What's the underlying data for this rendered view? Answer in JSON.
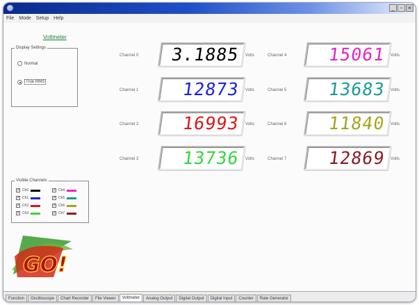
{
  "window": {
    "controls": {
      "minimize": "_",
      "restore": "▫",
      "close": "×"
    }
  },
  "menu": [
    "File",
    "Mode",
    "Setup",
    "Help"
  ],
  "panel": {
    "title": "Voltmeter"
  },
  "display_settings": {
    "legend": "Display Settings",
    "options": [
      {
        "label": "Normal",
        "selected": false
      },
      {
        "label": "True RMS",
        "selected": true
      }
    ]
  },
  "channels": [
    {
      "label": "Channel 0",
      "value": "3.1885",
      "unit": "Volts",
      "color": "#000000"
    },
    {
      "label": "Channel 1",
      "value": "12873",
      "unit": "Volts",
      "color": "#1a22d6"
    },
    {
      "label": "Channel 2",
      "value": "16993",
      "unit": "Volts",
      "color": "#e01414"
    },
    {
      "label": "Channel 3",
      "value": "13736",
      "unit": "Volts",
      "color": "#34d63a"
    },
    {
      "label": "Channel 4",
      "value": "15061",
      "unit": "Volts",
      "color": "#e623c9"
    },
    {
      "label": "Channel 5",
      "value": "13683",
      "unit": "Volts",
      "color": "#1a9b91"
    },
    {
      "label": "Channel 6",
      "value": "11840",
      "unit": "Volts",
      "color": "#a7a31c"
    },
    {
      "label": "Channel 7",
      "value": "12869",
      "unit": "Volts",
      "color": "#8a1a24"
    }
  ],
  "visible_channels": {
    "legend": "Visible Channels",
    "items": [
      {
        "label": "Ch0",
        "checked": true,
        "color": "#000000"
      },
      {
        "label": "Ch1",
        "checked": true,
        "color": "#1a22d6"
      },
      {
        "label": "Ch2",
        "checked": true,
        "color": "#e01414"
      },
      {
        "label": "Ch3",
        "checked": true,
        "color": "#34d63a"
      },
      {
        "label": "Ch4",
        "checked": true,
        "color": "#e623c9"
      },
      {
        "label": "Ch5",
        "checked": true,
        "color": "#1a9b91"
      },
      {
        "label": "Ch6",
        "checked": true,
        "color": "#a7a31c"
      },
      {
        "label": "Ch7",
        "checked": true,
        "color": "#8a1a24"
      }
    ]
  },
  "logo": {
    "text": "GO!"
  },
  "tabs": [
    {
      "label": "Function",
      "active": false
    },
    {
      "label": "Oscilloscope",
      "active": false
    },
    {
      "label": "Chart Recorder",
      "active": false
    },
    {
      "label": "File Viewer",
      "active": false
    },
    {
      "label": "Voltmeter",
      "active": true
    },
    {
      "label": "Analog Output",
      "active": false
    },
    {
      "label": "Digital Output",
      "active": false
    },
    {
      "label": "Digital Input",
      "active": false
    },
    {
      "label": "Counter",
      "active": false
    },
    {
      "label": "Rate Generator",
      "active": false
    }
  ]
}
